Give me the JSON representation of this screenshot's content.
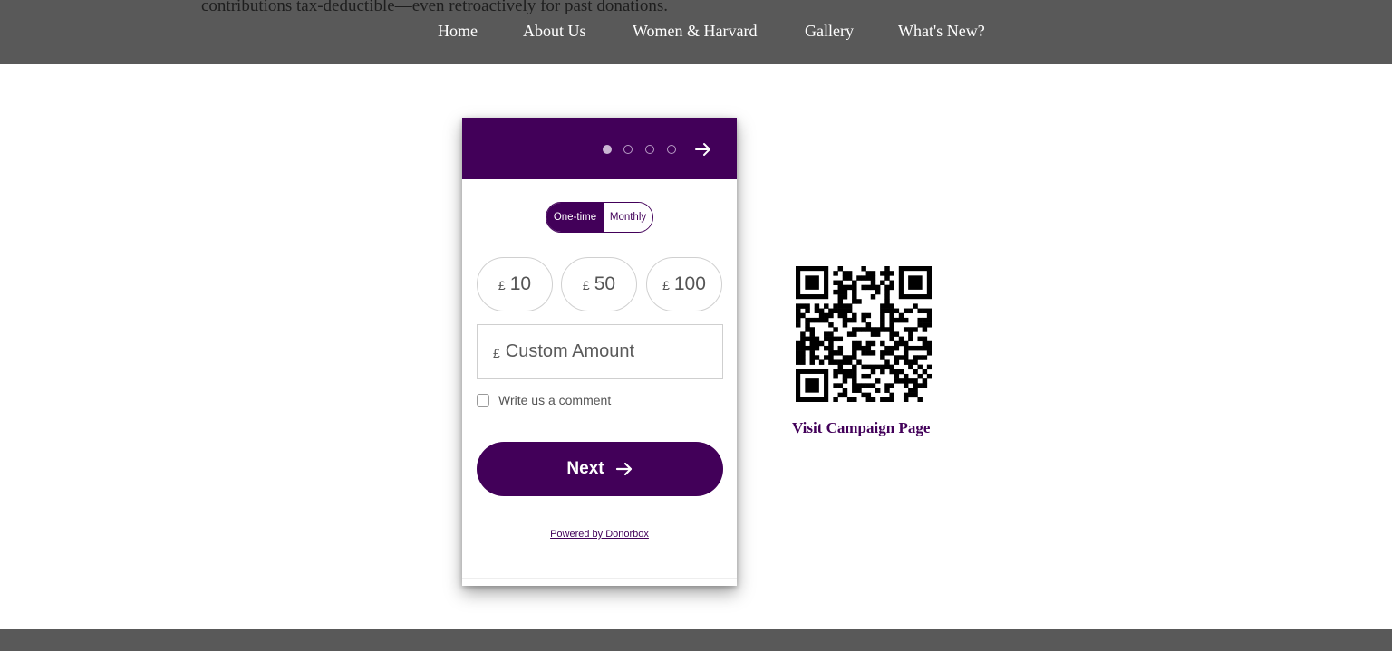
{
  "header": {
    "cut_text": "contributions tax-deductible—even retroactively for past donations.",
    "nav": [
      "Home",
      "About Us",
      "Women & Harvard",
      "Gallery",
      "What's New?"
    ]
  },
  "widget": {
    "steps_total": 4,
    "steps_current": 1,
    "frequency": {
      "one_time": "One-time",
      "monthly": "Monthly",
      "selected": "One-time"
    },
    "currency": "£",
    "amounts": [
      "10",
      "50",
      "100"
    ],
    "custom_placeholder": "Custom Amount",
    "comment_label": "Write us a comment",
    "next_label": "Next",
    "powered_by": "Powered by Donorbox"
  },
  "campaign": {
    "link_label": "Visit Campaign Page"
  },
  "colors": {
    "brand": "#420059",
    "bar": "#595959"
  }
}
